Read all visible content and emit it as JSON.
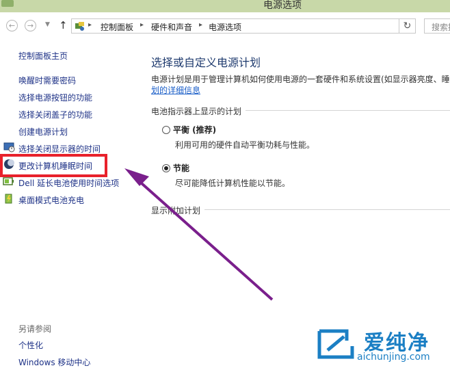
{
  "window": {
    "title": "电源选项"
  },
  "nav": {
    "breadcrumb": [
      "控制面板",
      "硬件和声音",
      "电源选项"
    ],
    "search_placeholder": "搜索控"
  },
  "sidebar": {
    "home": "控制面板主页",
    "items": [
      {
        "label": "唤醒时需要密码",
        "icon": null
      },
      {
        "label": "选择电源按钮的功能",
        "icon": null
      },
      {
        "label": "选择关闭盖子的功能",
        "icon": null
      },
      {
        "label": "创建电源计划",
        "icon": null
      },
      {
        "label": "选择关闭显示器的时间",
        "icon": "monitor-clock-icon"
      },
      {
        "label": "更改计算机睡眠时间",
        "icon": "moon-icon"
      },
      {
        "label": "Dell 延长电池使用时间选项",
        "icon": "dell-battery-icon"
      },
      {
        "label": "桌面模式电池充电",
        "icon": "battery-charge-icon"
      }
    ],
    "see_also_heading": "另请参阅",
    "see_also": [
      "个性化",
      "Windows 移动中心"
    ]
  },
  "main": {
    "title": "选择或自定义电源计划",
    "description": "电源计划是用于管理计算机如何使用电源的一套硬件和系统设置(如显示器亮度、睡",
    "description_link": "划的详细信息",
    "battery_group_label": "电池指示器上显示的计划",
    "plans": [
      {
        "name": "平衡 (推荐)",
        "desc": "利用可用的硬件自动平衡功耗与性能。",
        "selected": false
      },
      {
        "name": "节能",
        "desc": "尽可能降低计算机性能以节能。",
        "selected": true
      }
    ],
    "extra_group_label": "显示附加计划"
  },
  "watermark": {
    "text": "爱纯净",
    "url": "aichunjing.com"
  },
  "colors": {
    "highlight_box": "#e8212b",
    "arrow": "#7a1f8c",
    "link": "#1e3287",
    "watermark": "#1b7fc4"
  }
}
